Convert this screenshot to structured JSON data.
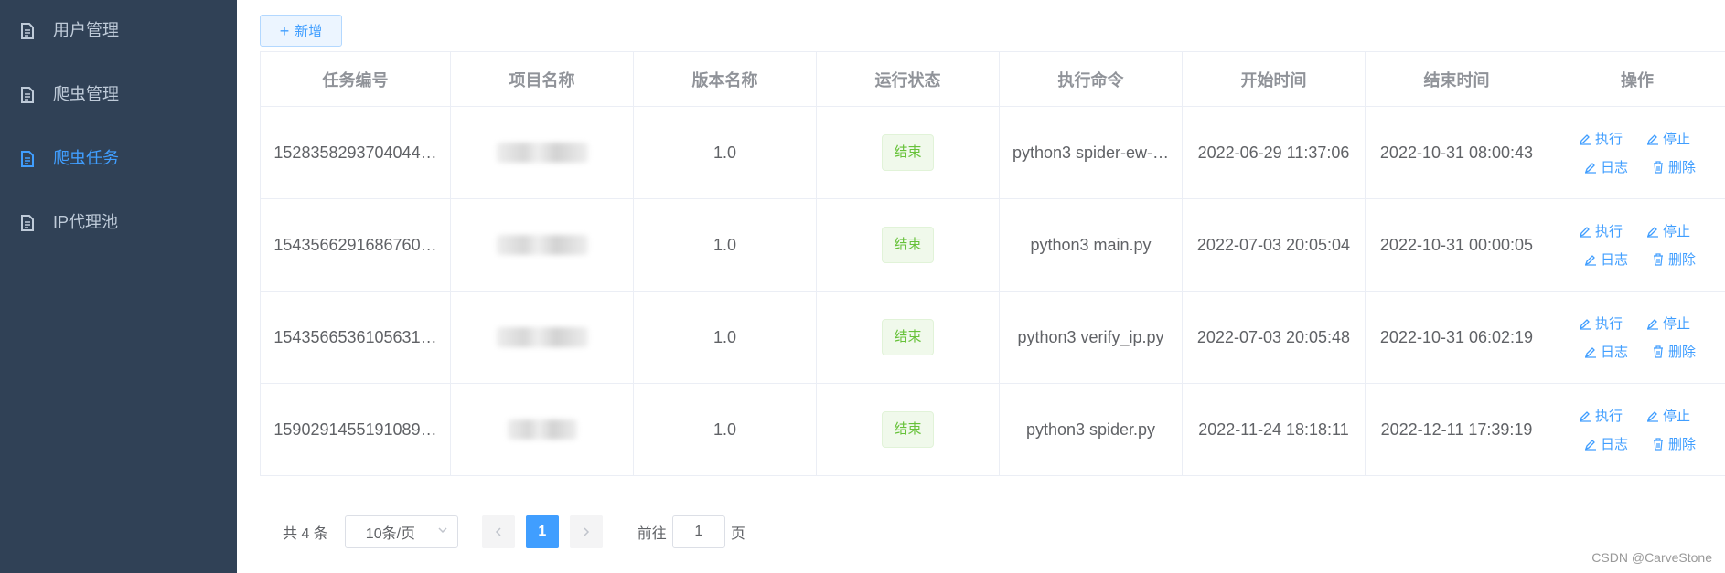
{
  "sidebar": {
    "items": [
      {
        "label": "用户管理",
        "icon": "document-icon",
        "active": false
      },
      {
        "label": "爬虫管理",
        "icon": "document-icon",
        "active": false
      },
      {
        "label": "爬虫任务",
        "icon": "document-icon",
        "active": true
      },
      {
        "label": "IP代理池",
        "icon": "document-icon",
        "active": false
      }
    ]
  },
  "toolbar": {
    "add_label": "新增",
    "add_icon": "plus-icon"
  },
  "table": {
    "headers": [
      "任务编号",
      "项目名称",
      "版本名称",
      "运行状态",
      "执行命令",
      "开始时间",
      "结束时间",
      "操作"
    ],
    "rows": [
      {
        "id": "1528358293704044…",
        "project": "",
        "version": "1.0",
        "status": "结束",
        "command": "python3 spider-ew-…",
        "start": "2022-06-29 11:37:06",
        "end": "2022-10-31 08:00:43"
      },
      {
        "id": "1543566291686760…",
        "project": "",
        "version": "1.0",
        "status": "结束",
        "command": "python3 main.py",
        "start": "2022-07-03 20:05:04",
        "end": "2022-10-31 00:00:05"
      },
      {
        "id": "1543566536105631…",
        "project": "",
        "version": "1.0",
        "status": "结束",
        "command": "python3 verify_ip.py",
        "start": "2022-07-03 20:05:48",
        "end": "2022-10-31 06:02:19"
      },
      {
        "id": "1590291455191089…",
        "project": "",
        "version": "1.0",
        "status": "结束",
        "command": "python3 spider.py",
        "start": "2022-11-24 18:18:11",
        "end": "2022-12-11 17:39:19"
      }
    ],
    "actions": {
      "run": "执行",
      "stop": "停止",
      "log": "日志",
      "delete": "删除"
    }
  },
  "pagination": {
    "total": "共 4 条",
    "page_size": "10条/页",
    "current_page": "1",
    "goto_prefix": "前往",
    "goto_value": "1",
    "goto_suffix": "页"
  },
  "watermark": "CSDN @CarveStone",
  "colors": {
    "sidebar_bg": "#304156",
    "accent": "#409eff",
    "success": "#67c23a"
  }
}
